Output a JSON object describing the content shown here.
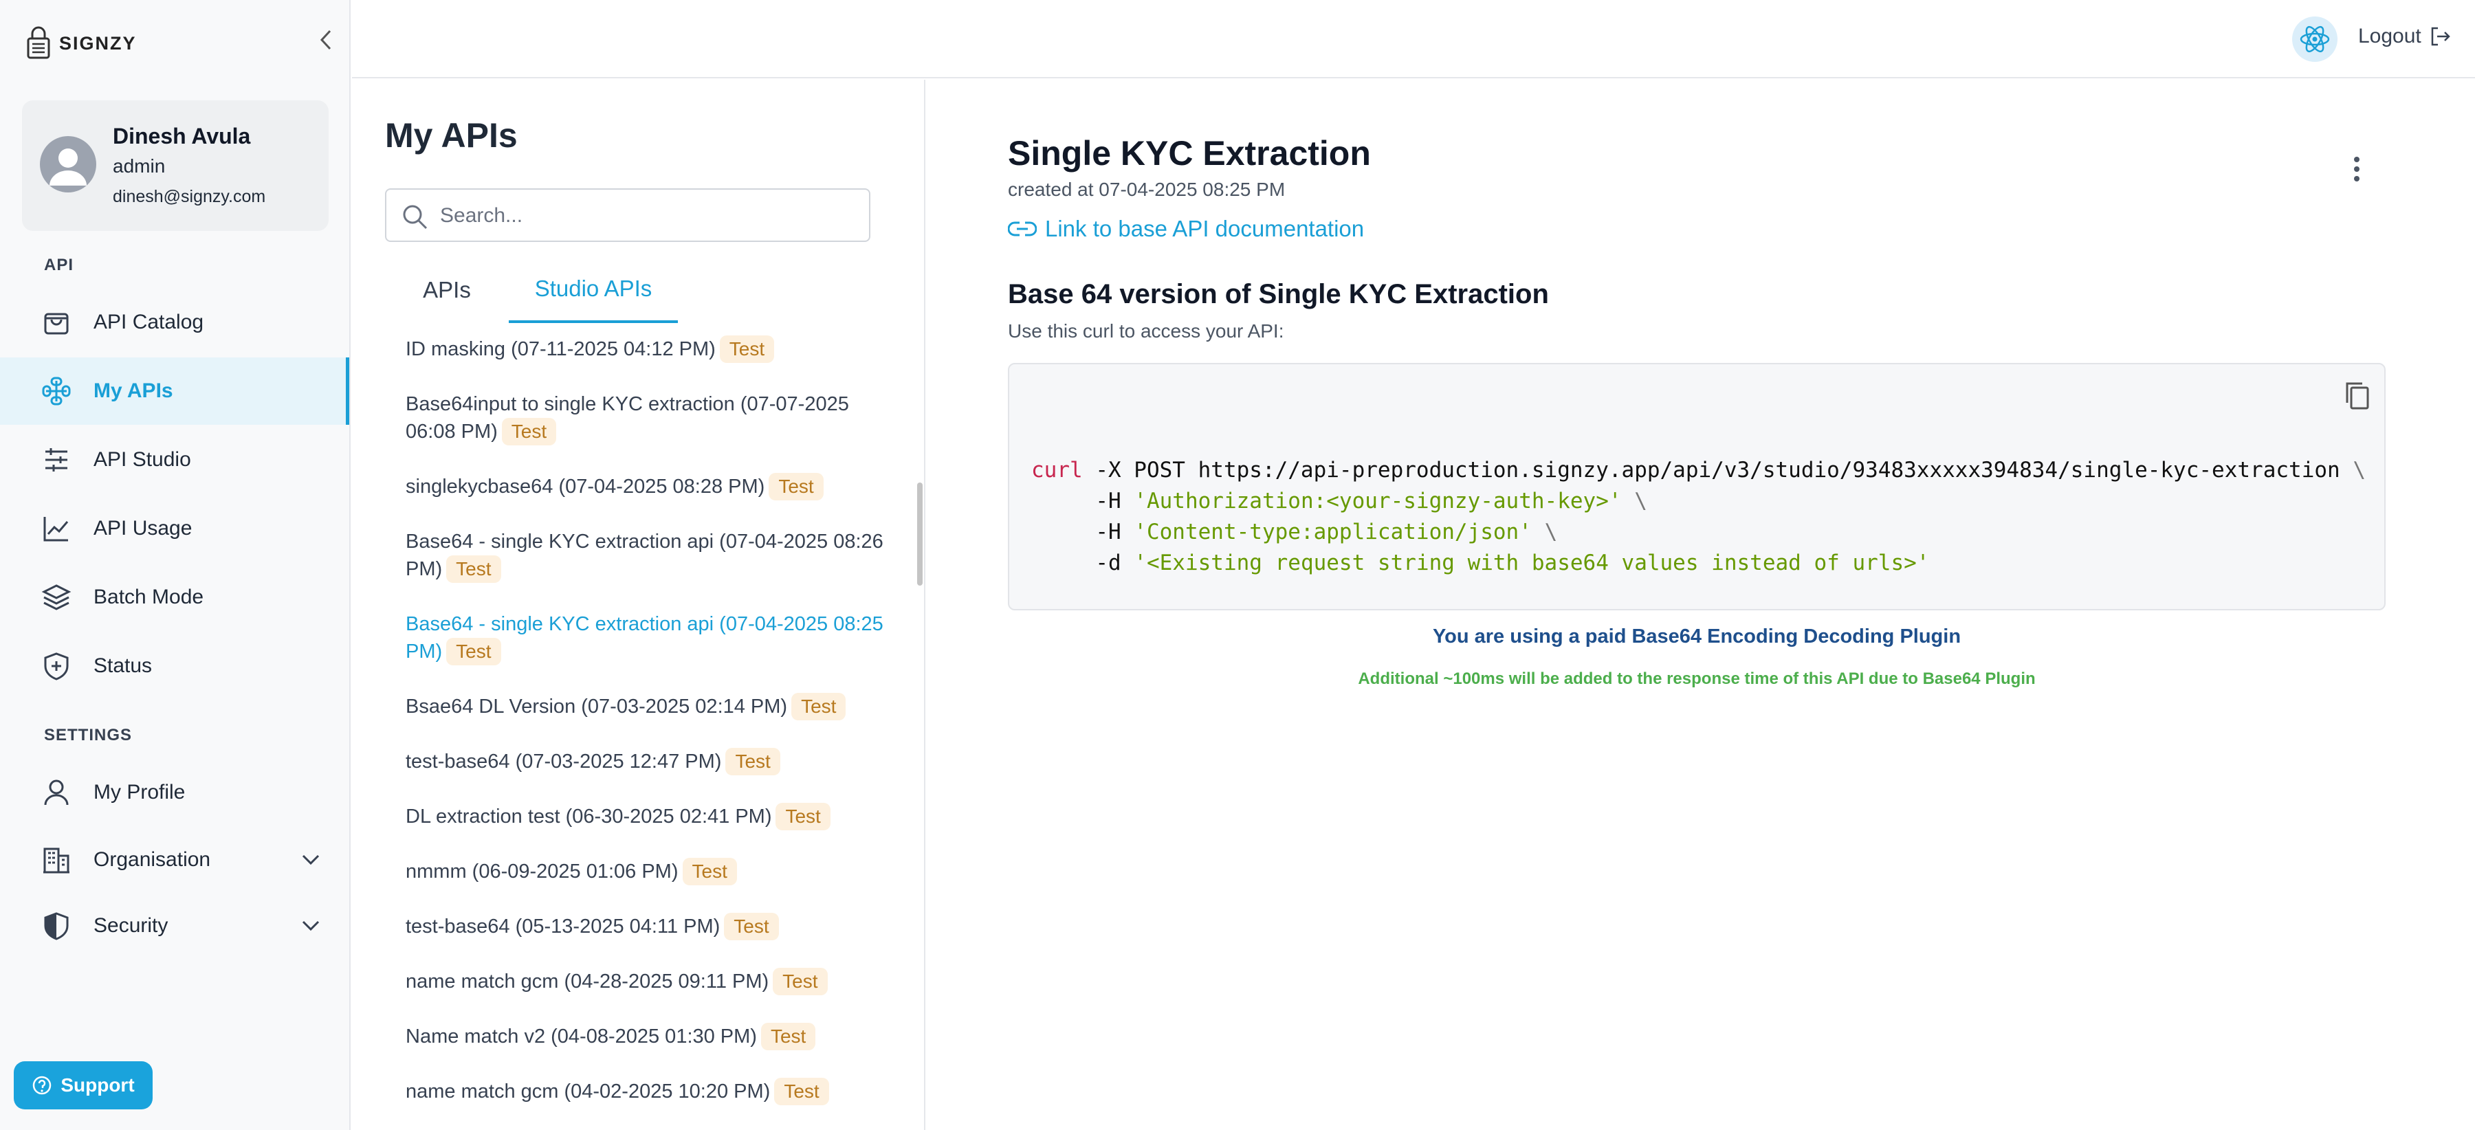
{
  "brand": {
    "name": "SIGNZY"
  },
  "profile": {
    "name": "Dinesh Avula",
    "role": "admin",
    "email": "dinesh@signzy.com"
  },
  "sidebar": {
    "api_section": "API",
    "settings_section": "SETTINGS",
    "items": [
      {
        "label": "API Catalog",
        "icon": "bag-icon"
      },
      {
        "label": "My APIs",
        "icon": "api-icon"
      },
      {
        "label": "API Studio",
        "icon": "sliders-icon"
      },
      {
        "label": "API Usage",
        "icon": "chart-icon"
      },
      {
        "label": "Batch Mode",
        "icon": "layers-icon"
      },
      {
        "label": "Status",
        "icon": "shield-plus-icon"
      }
    ],
    "settings_items": [
      {
        "label": "My Profile",
        "icon": "user-icon"
      },
      {
        "label": "Organisation",
        "icon": "building-icon"
      },
      {
        "label": "Security",
        "icon": "shield-icon"
      }
    ],
    "support_label": "Support"
  },
  "topbar": {
    "logout_label": "Logout"
  },
  "list": {
    "title": "My APIs",
    "search_placeholder": "Search...",
    "tabs": [
      "APIs",
      "Studio APIs"
    ],
    "items": [
      {
        "name": "ID masking (07-11-2025 04:12 PM)",
        "badge": "Test"
      },
      {
        "name": "Base64input to single KYC extraction (07-07-2025 06:08 PM)",
        "badge": "Test"
      },
      {
        "name": "singlekycbase64 (07-04-2025 08:28 PM)",
        "badge": "Test"
      },
      {
        "name": "Base64 - single KYC extraction api (07-04-2025 08:26 PM)",
        "badge": "Test"
      },
      {
        "name": "Base64 - single KYC extraction api (07-04-2025 08:25 PM)",
        "badge": "Test"
      },
      {
        "name": "Bsae64 DL Version (07-03-2025 02:14 PM)",
        "badge": "Test"
      },
      {
        "name": "test-base64 (07-03-2025 12:47 PM)",
        "badge": "Test"
      },
      {
        "name": "DL extraction test (06-30-2025 02:41 PM)",
        "badge": "Test"
      },
      {
        "name": "nmmm (06-09-2025 01:06 PM)",
        "badge": "Test"
      },
      {
        "name": "test-base64 (05-13-2025 04:11 PM)",
        "badge": "Test"
      },
      {
        "name": "name match gcm (04-28-2025 09:11 PM)",
        "badge": "Test"
      },
      {
        "name": "Name match v2 (04-08-2025 01:30 PM)",
        "badge": "Test"
      },
      {
        "name": "name match gcm (04-02-2025 10:20 PM)",
        "badge": "Test"
      }
    ]
  },
  "detail": {
    "title": "Single KYC Extraction",
    "created": "created at 07-04-2025 08:25 PM",
    "doc_link": "Link to base API documentation",
    "subtitle": "Base 64 version of Single KYC Extraction",
    "hint": "Use this curl to access your API:",
    "curl": {
      "cmd": "curl",
      "line1_rest": " -X POST https://api-preproduction.signzy.app/api/v3/studio/93483xxxxx394834/single-kyc-extraction ",
      "h_flag": "     -H ",
      "auth_header": "'Authorization:<your-signzy-auth-key>'",
      "content_header": "'Content-type:application/json'",
      "d_flag": "     -d ",
      "body": "'<Existing request string with base64 values instead of urls>'",
      "bs": "\\"
    },
    "paid_notice": "You are using a paid Base64 Encoding Decoding Plugin",
    "latency_note": "Additional ~100ms will be added to the response time of this API due to Base64 Plugin"
  }
}
